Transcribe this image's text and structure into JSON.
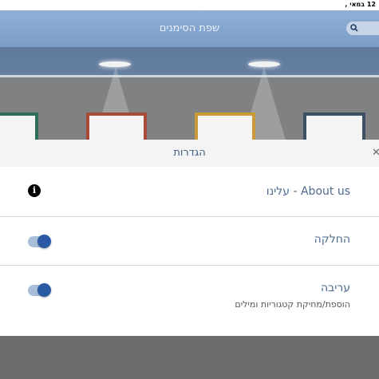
{
  "status_bar": {
    "time": "12 במאי ,"
  },
  "app": {
    "title": "שפת הסימנים",
    "search_icon": "search-icon"
  },
  "settings": {
    "title": "הגדרות",
    "close_glyph": "✕",
    "items": [
      {
        "label": "About us - עלינו",
        "control": "info-icon",
        "icon_glyph": "i"
      },
      {
        "label": "החלקה",
        "control": "toggle",
        "toggle_on": true
      },
      {
        "label": "עריבה",
        "sublabel": "הוספת/מחיקת קטגוריות ומילים",
        "control": "toggle",
        "toggle_on": true
      }
    ]
  },
  "colors": {
    "accent": "#2a5aa5",
    "toggle_track": "#a9bfd9",
    "label_text": "#4d6b8e",
    "header_title": "#3d5e84"
  }
}
